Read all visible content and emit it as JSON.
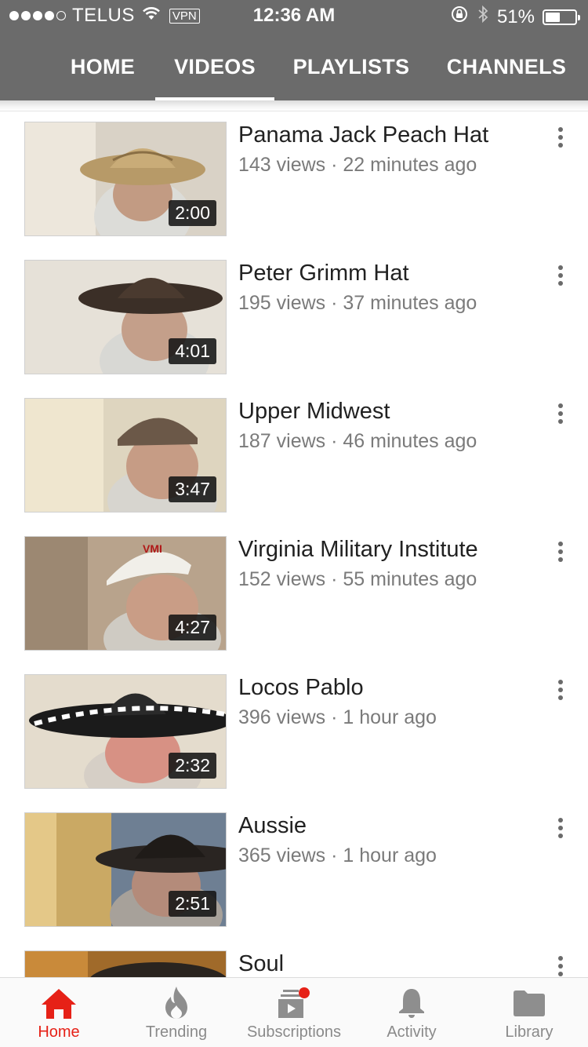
{
  "status_bar": {
    "carrier": "TELUS",
    "vpn": "VPN",
    "time": "12:36 AM",
    "battery": "51%",
    "battery_level": 0.51
  },
  "tabs": [
    {
      "label": "HOME",
      "active": false
    },
    {
      "label": "VIDEOS",
      "active": true
    },
    {
      "label": "PLAYLISTS",
      "active": false
    },
    {
      "label": "CHANNELS",
      "active": false
    }
  ],
  "videos": [
    {
      "title": "Panama Jack Peach Hat",
      "meta": "143 views · 22 minutes ago",
      "duration": "2:00"
    },
    {
      "title": "Peter Grimm Hat",
      "meta": "195 views · 37 minutes ago",
      "duration": "4:01"
    },
    {
      "title": "Upper Midwest",
      "meta": "187 views · 46 minutes ago",
      "duration": "3:47"
    },
    {
      "title": "Virginia Military Institute",
      "meta": "152 views · 55 minutes ago",
      "duration": "4:27"
    },
    {
      "title": "Locos Pablo",
      "meta": "396 views · 1 hour ago",
      "duration": "2:32"
    },
    {
      "title": "Aussie",
      "meta": "365 views · 1 hour ago",
      "duration": "2:51"
    },
    {
      "title": "Soul",
      "meta": "",
      "duration": ""
    }
  ],
  "bottom_nav": [
    {
      "label": "Home",
      "icon": "home-icon",
      "active": true
    },
    {
      "label": "Trending",
      "icon": "flame-icon",
      "active": false
    },
    {
      "label": "Subscriptions",
      "icon": "subscriptions-icon",
      "active": false
    },
    {
      "label": "Activity",
      "icon": "bell-icon",
      "active": false
    },
    {
      "label": "Library",
      "icon": "folder-icon",
      "active": false
    }
  ],
  "colors": {
    "header": "#6b6b6b",
    "accent": "#e62117",
    "title_text": "#212121",
    "meta_text": "#7a7a7a"
  }
}
